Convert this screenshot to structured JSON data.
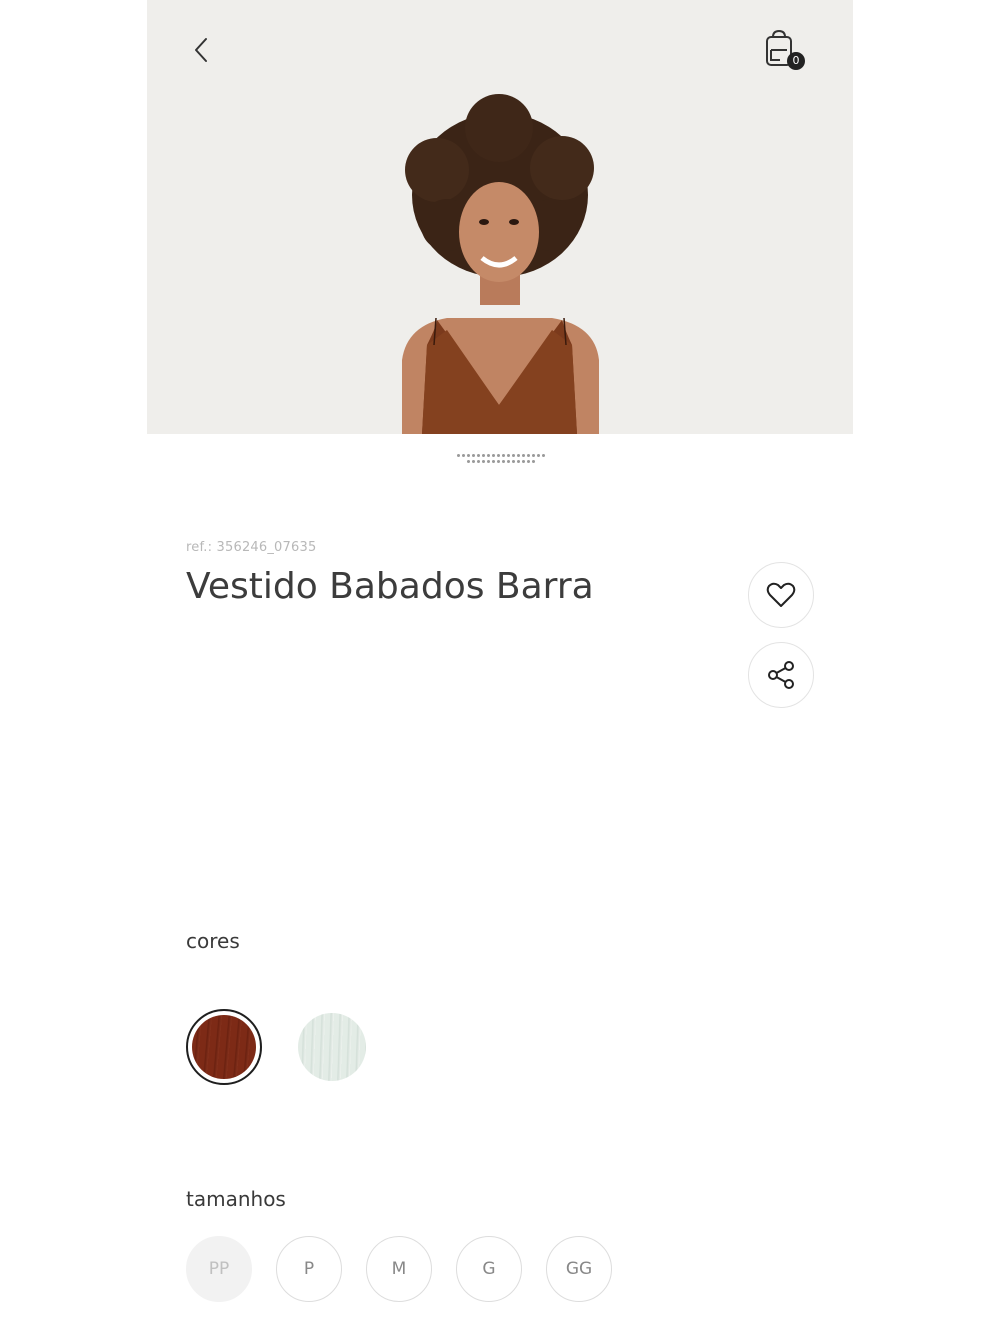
{
  "header": {
    "back_icon": "chevron-left-icon",
    "bag_icon": "shopping-bag-icon",
    "bag_count": "0"
  },
  "product": {
    "ref": "ref.: 356246_07635",
    "title": "Vestido Babados Barra",
    "favorite_icon": "heart-icon",
    "share_icon": "share-icon"
  },
  "gallery": {
    "image_count": 16,
    "current_index": 0
  },
  "colors": {
    "label": "cores",
    "swatches": [
      {
        "name": "terracota",
        "color": "#7d2a16",
        "selected": true
      },
      {
        "name": "off-white",
        "color": "#e3ece6",
        "selected": false
      }
    ]
  },
  "sizes": {
    "label": "tamanhos",
    "options": [
      {
        "label": "PP",
        "available": false
      },
      {
        "label": "P",
        "available": true
      },
      {
        "label": "M",
        "available": true
      },
      {
        "label": "G",
        "available": true
      },
      {
        "label": "GG",
        "available": true
      }
    ]
  }
}
